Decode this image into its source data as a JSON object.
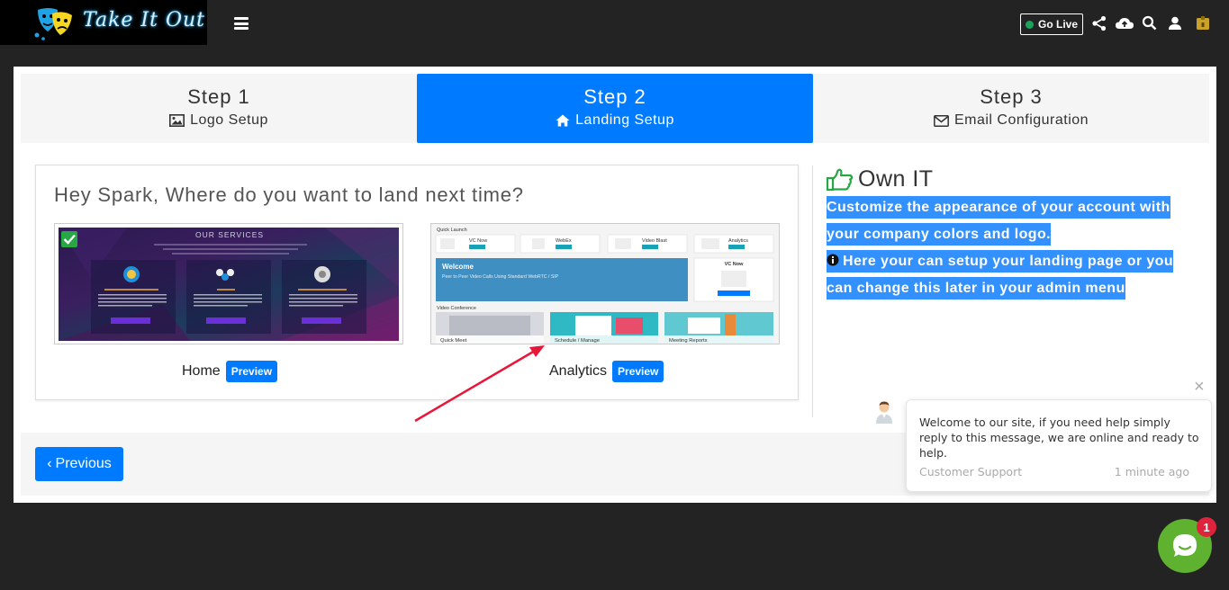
{
  "header": {
    "logo_text": "Take It Out",
    "go_live_label": "Go Live",
    "icons": [
      "share-icon",
      "cloud-upload-icon",
      "search-icon",
      "user-icon",
      "badge-icon"
    ]
  },
  "steps": [
    {
      "title": "Step 1",
      "subtitle": "Logo Setup",
      "icon": "image-icon",
      "active": false
    },
    {
      "title": "Step 2",
      "subtitle": "Landing Setup",
      "icon": "home-icon",
      "active": true
    },
    {
      "title": "Step 3",
      "subtitle": "Email Configuration",
      "icon": "envelope-icon",
      "active": false
    }
  ],
  "landing": {
    "question": "Hey Spark, Where do you want to land next time?",
    "options": [
      {
        "label": "Home",
        "preview_label": "Preview",
        "selected": true
      },
      {
        "label": "Analytics",
        "preview_label": "Preview",
        "selected": false
      }
    ],
    "home_thumb": {
      "heading": "OUR SERVICES"
    },
    "analytics_thumb": {
      "quick_launch": "Quick Launch",
      "tiles": [
        "VC Now",
        "WebEx",
        "Video Blast",
        "Analytics"
      ],
      "welcome": "Welcome",
      "welcome_sub": "Peer to Peer Video Calls Using Standard WebRTC / SIP",
      "side_tile": "VC Now",
      "section": "Video Conference",
      "bottom": [
        "Quick Meet",
        "Schedule / Manage",
        "Meeting Reports"
      ]
    }
  },
  "own_it": {
    "title": "Own IT",
    "line1": "Customize the appearance of your account with your company colors and logo.",
    "line2": "Here your can setup your landing page or you can change this later in your admin menu"
  },
  "nav": {
    "previous_label": "Previous"
  },
  "chat": {
    "message": "Welcome to our site, if you need help simply reply to this message, we are online and ready to help.",
    "from": "Customer Support",
    "time": "1 minute ago",
    "badge_count": "1"
  },
  "colors": {
    "primary": "#007bff",
    "highlight": "#3390ff",
    "chat_green": "#5fb130",
    "badge_red": "#e0233d",
    "arrow_red": "#e8173a"
  }
}
